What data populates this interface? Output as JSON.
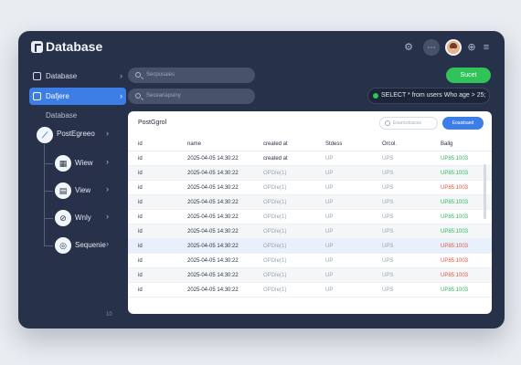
{
  "app": {
    "title": "Database",
    "toolbar_icons": [
      "gear-icon",
      "chat-icon",
      "avatar",
      "compass-icon",
      "menu-icon"
    ]
  },
  "sidebar": {
    "items": [
      {
        "label": "Database",
        "icon": "database-icon",
        "active": false
      },
      {
        "label": "Dafjere",
        "icon": "table-icon",
        "active": true
      },
      {
        "label": "Database",
        "icon": "",
        "active": false
      }
    ],
    "connection": {
      "label": "PostEgreeo"
    },
    "tree": [
      {
        "label": "Wiew",
        "icon": "grid-icon"
      },
      {
        "label": "View",
        "icon": "list-icon"
      },
      {
        "label": "Wnly",
        "icon": "link-icon"
      },
      {
        "label": "Sequenie",
        "icon": "gear-icon"
      }
    ],
    "footer": "10"
  },
  "search_primary": {
    "placeholder": "Secpusaies"
  },
  "search_secondary": {
    "placeholder": "Seceariapsiny"
  },
  "run_button": {
    "label": "Sucet"
  },
  "query": {
    "text": "SELECT * from users Who age > 25;",
    "status_color": "#2fc35a"
  },
  "panel": {
    "title": "PostGgrol",
    "filter_placeholder": "Eoaricstcacss",
    "action_button": "Eoaisbaed",
    "columns": [
      "id",
      "name",
      "created at",
      "Stdess",
      "Orcol.",
      "Ballg"
    ],
    "rows": [
      {
        "id": "id",
        "name": "2025-04-05 14:30:22",
        "created": "created at",
        "status": "UP",
        "order": "UPS",
        "badge": "UP85:1003",
        "badge_color": "#2fb85a"
      },
      {
        "id": "id",
        "name": "2025-04-05 14:30:22",
        "created": "OPDIe(1)",
        "status": "UP",
        "order": "UPS",
        "badge": "UP85:1003",
        "badge_color": "#2fb85a"
      },
      {
        "id": "id",
        "name": "2025-04-05 14:30:22",
        "created": "OPDIe(1)",
        "status": "UP",
        "order": "UPS",
        "badge": "UP85:1003",
        "badge_color": "#e0553f"
      },
      {
        "id": "id",
        "name": "2025-04-05 14:30:22",
        "created": "OPDIe(1)",
        "status": "UP",
        "order": "UPS",
        "badge": "UP85:1003",
        "badge_color": "#2fb85a"
      },
      {
        "id": "id",
        "name": "2025-04-05 14:30:22",
        "created": "OPDIe(1)",
        "status": "UP",
        "order": "UPS",
        "badge": "UP85:1003",
        "badge_color": "#2fb85a"
      },
      {
        "id": "id",
        "name": "2025-04-05 14:30:22",
        "created": "OPDIe(1)",
        "status": "UP",
        "order": "UPS",
        "badge": "UP85:1003",
        "badge_color": "#2fb85a"
      },
      {
        "id": "id",
        "name": "2025-04-05 14:30:22",
        "created": "OPDIe(1)",
        "status": "UP",
        "order": "UPS",
        "badge": "UP85:1003",
        "badge_color": "#e0553f"
      },
      {
        "id": "id",
        "name": "2025-04-05 14:30:22",
        "created": "OPDIe(1)",
        "status": "UP",
        "order": "UPS",
        "badge": "UP85:1003",
        "badge_color": "#e0553f"
      },
      {
        "id": "id",
        "name": "2025-04-05 14:30:22",
        "created": "OPDIe(1)",
        "status": "UP",
        "order": "UPS",
        "badge": "UP85:1003",
        "badge_color": "#e0553f"
      },
      {
        "id": "id",
        "name": "2025-04-05 14:30:22",
        "created": "OPDIe(1)",
        "status": "UP",
        "order": "UPS",
        "badge": "UP85:1003",
        "badge_color": "#2fb85a"
      }
    ]
  },
  "colors": {
    "frame": "#27324a",
    "accent": "#3d7de6",
    "success": "#2fc35a",
    "danger": "#e0553f"
  }
}
